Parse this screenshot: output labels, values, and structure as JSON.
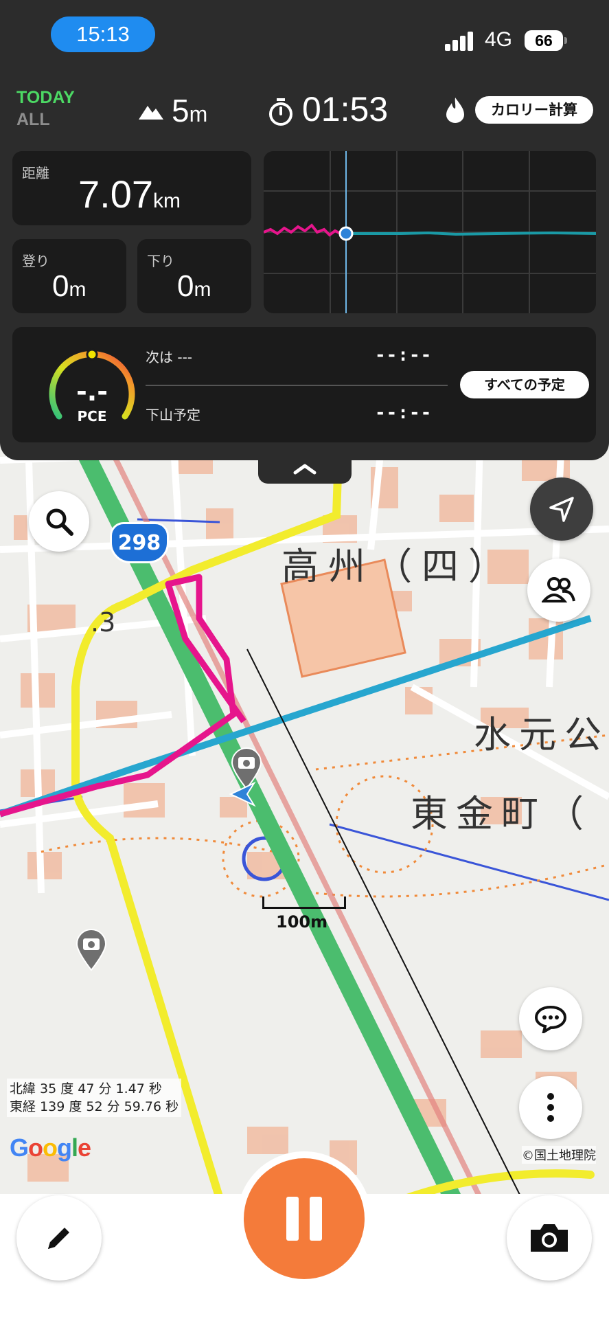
{
  "status_bar": {
    "time": "15:13",
    "network": "4G",
    "battery": "66"
  },
  "summary": {
    "filter_today": "TODAY",
    "filter_all": "ALL",
    "elevation_value": "5",
    "elevation_unit": "m",
    "elapsed_time": "01:53",
    "calorie_button": "カロリー計算"
  },
  "stats": {
    "distance_label": "距離",
    "distance_value": "7.07",
    "distance_unit": "km",
    "ascent_label": "登り",
    "ascent_value": "0",
    "ascent_unit": "m",
    "descent_label": "下り",
    "descent_value": "0",
    "descent_unit": "m"
  },
  "pace": {
    "value": "-.-",
    "label": "PCE",
    "next_label": "次は ---",
    "next_time": "--:--",
    "descent_plan_label": "下山予定",
    "descent_plan_time": "--:--",
    "all_schedule_button": "すべての予定"
  },
  "map": {
    "place_takasu": "高州（四）",
    "place_mizumoto": "水元公",
    "place_higashikanamachi": "東金町（",
    "route_number": "298",
    "contour_label": "3",
    "scale_label": "100m",
    "latitude": "北緯 35 度 47 分 1.47 秒",
    "longitude": "東経 139 度 52 分 59.76 秒",
    "google_logo": "Google",
    "attribution": "©国土地理院"
  },
  "colors": {
    "accent_orange": "#f47b3a",
    "track_magenta": "#e6158c",
    "route_blue": "#27a6cf",
    "status_blue": "#1f8cf0",
    "today_green": "#4cd964"
  },
  "icons": [
    "search-icon",
    "navigation-arrow-icon",
    "group-icon",
    "chat-icon",
    "more-vertical-icon",
    "pencil-icon",
    "pause-icon",
    "camera-icon",
    "flame-icon",
    "stopwatch-icon",
    "mountain-icon",
    "chevron-up-icon"
  ]
}
